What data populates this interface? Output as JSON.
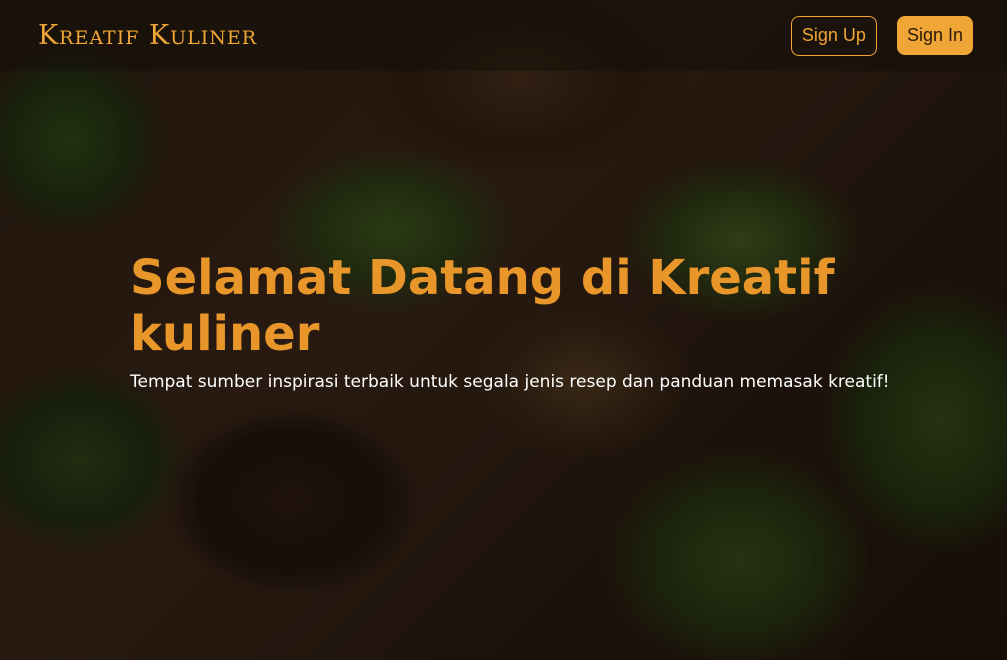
{
  "navbar": {
    "brand": "Kreatif Kuliner",
    "signup_label": "Sign Up",
    "signin_label": "Sign In"
  },
  "hero": {
    "title": "Selamat Datang di Kreatif kuliner",
    "subtitle": "Tempat sumber inspirasi terbaik untuk segala jenis resep dan panduan memasak kreatif!",
    "background_image": "food-spread-photo"
  },
  "colors": {
    "accent": "#f0a636",
    "title": "#e8962a",
    "text": "#ffffff"
  }
}
